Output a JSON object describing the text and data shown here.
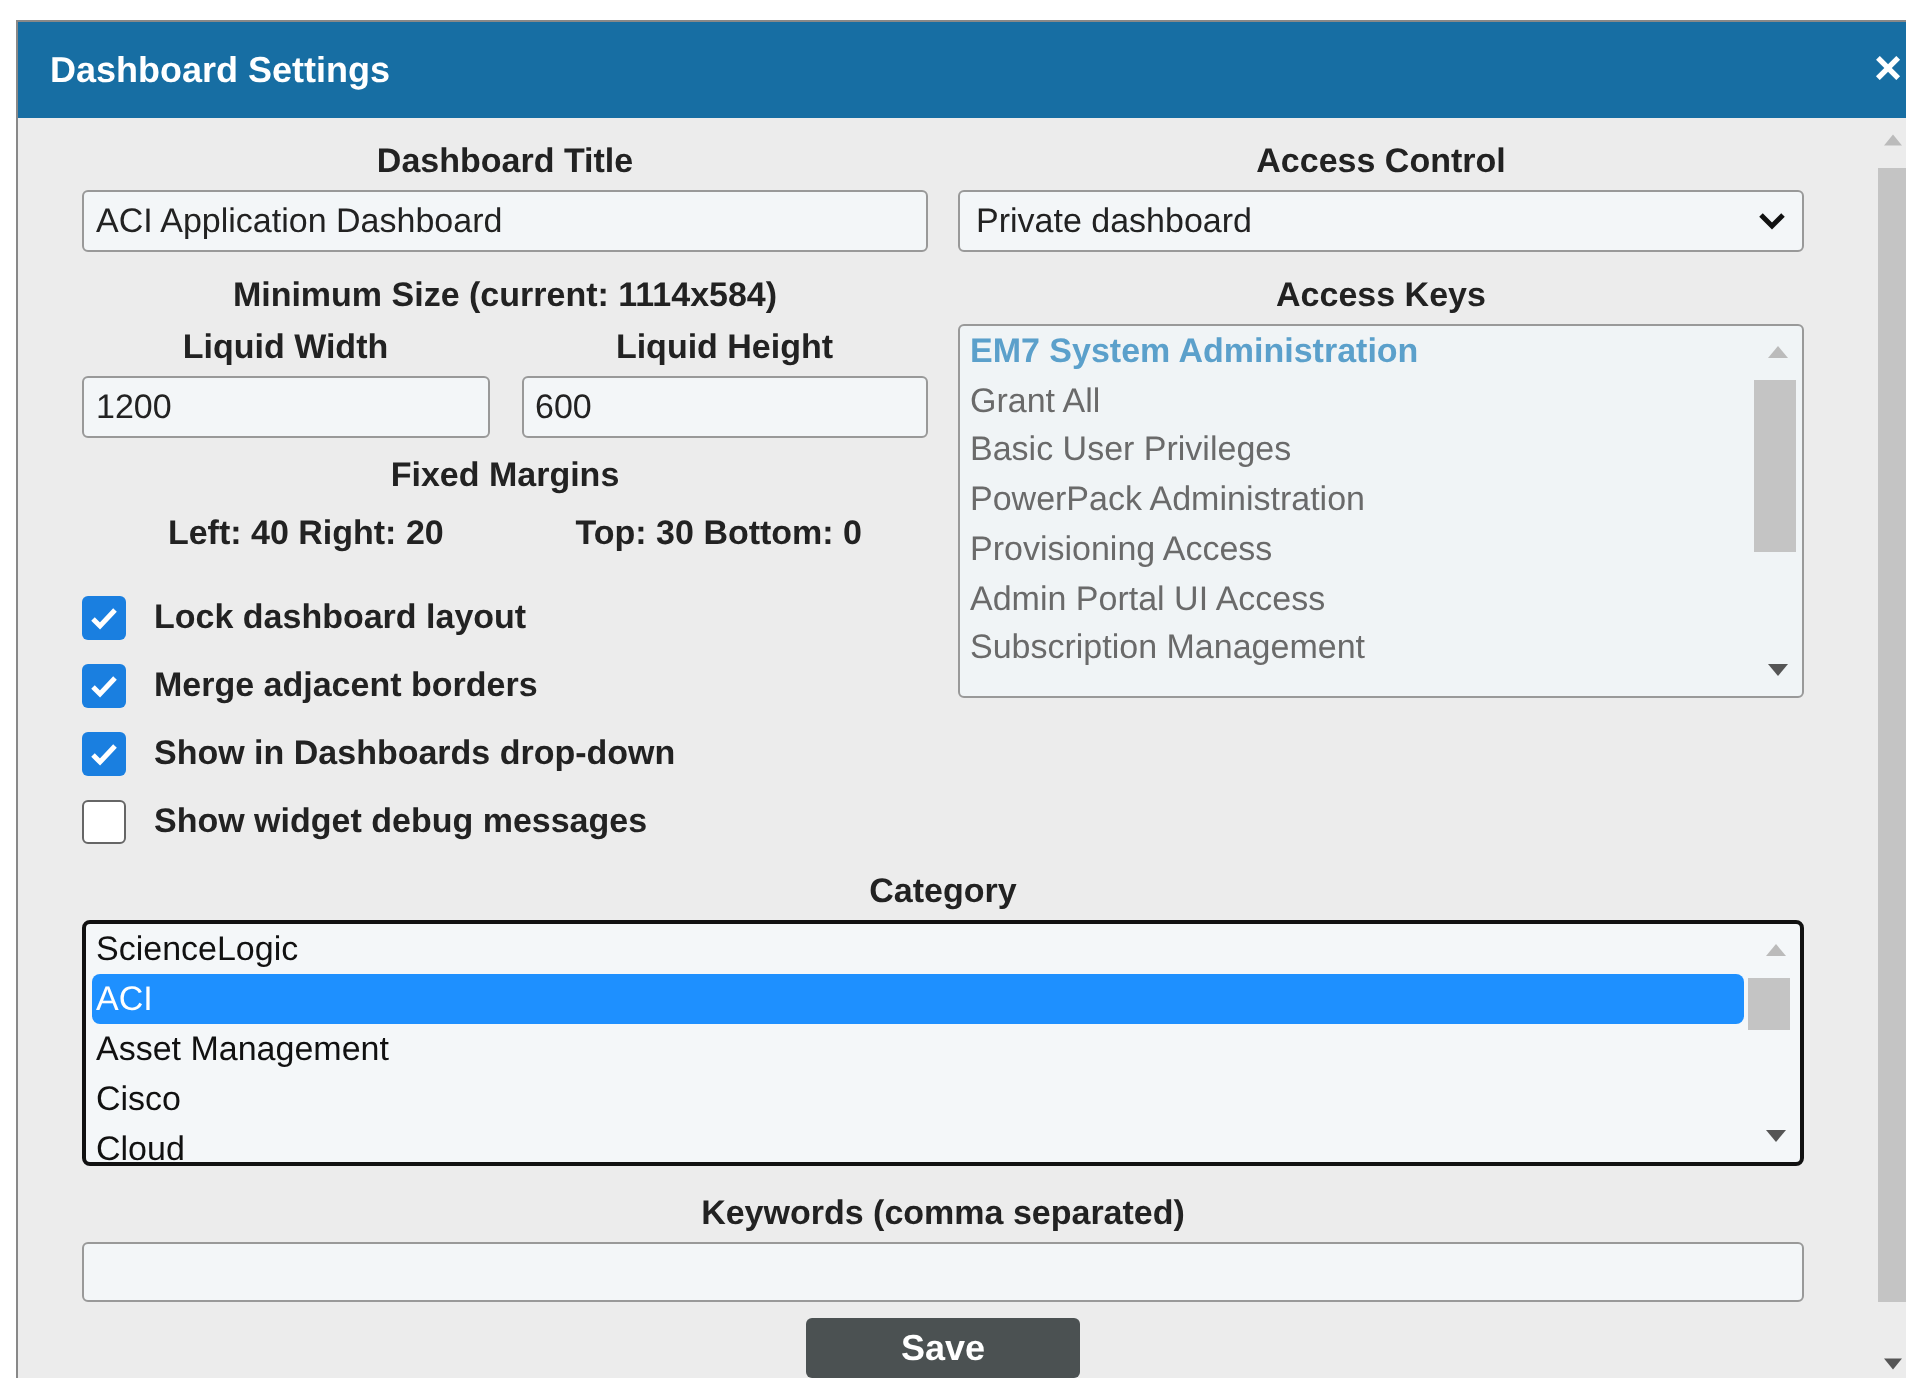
{
  "window": {
    "title": "Dashboard Settings",
    "close": "×"
  },
  "dashboard_title": {
    "label": "Dashboard Title",
    "value": "ACI Application Dashboard"
  },
  "access_control": {
    "label": "Access Control",
    "value": "Private dashboard"
  },
  "minimum_size": {
    "label": "Minimum Size (current: 1114x584)",
    "width": {
      "label": "Liquid Width",
      "value": "1200"
    },
    "height": {
      "label": "Liquid Height",
      "value": "600"
    }
  },
  "fixed_margins": {
    "label": "Fixed Margins",
    "horizontal": "Left: 40 Right: 20",
    "vertical": "Top: 30 Bottom: 0"
  },
  "access_keys": {
    "label": "Access Keys",
    "items": [
      {
        "kind": "group",
        "label": "EM7 System Administration"
      },
      {
        "kind": "key",
        "label": "Grant All"
      },
      {
        "kind": "key",
        "label": "Basic User Privileges"
      },
      {
        "kind": "key",
        "label": "PowerPack Administration"
      },
      {
        "kind": "key",
        "label": "Provisioning Access"
      },
      {
        "kind": "key",
        "label": "Admin Portal UI Access"
      },
      {
        "kind": "key",
        "label": "Subscription Management"
      }
    ]
  },
  "options": [
    {
      "label": "Lock dashboard layout",
      "checked": true
    },
    {
      "label": "Merge adjacent borders",
      "checked": true
    },
    {
      "label": "Show in Dashboards drop-down",
      "checked": true
    },
    {
      "label": "Show widget debug messages",
      "checked": false
    }
  ],
  "category": {
    "label": "Category",
    "items": [
      {
        "label": "ScienceLogic",
        "selected": false
      },
      {
        "label": "ACI",
        "selected": true
      },
      {
        "label": "Asset Management",
        "selected": false
      },
      {
        "label": "Cisco",
        "selected": false
      },
      {
        "label": "Cloud",
        "selected": false
      }
    ]
  },
  "keywords": {
    "label": "Keywords (comma separated)"
  },
  "buttons": [
    "Save"
  ]
}
